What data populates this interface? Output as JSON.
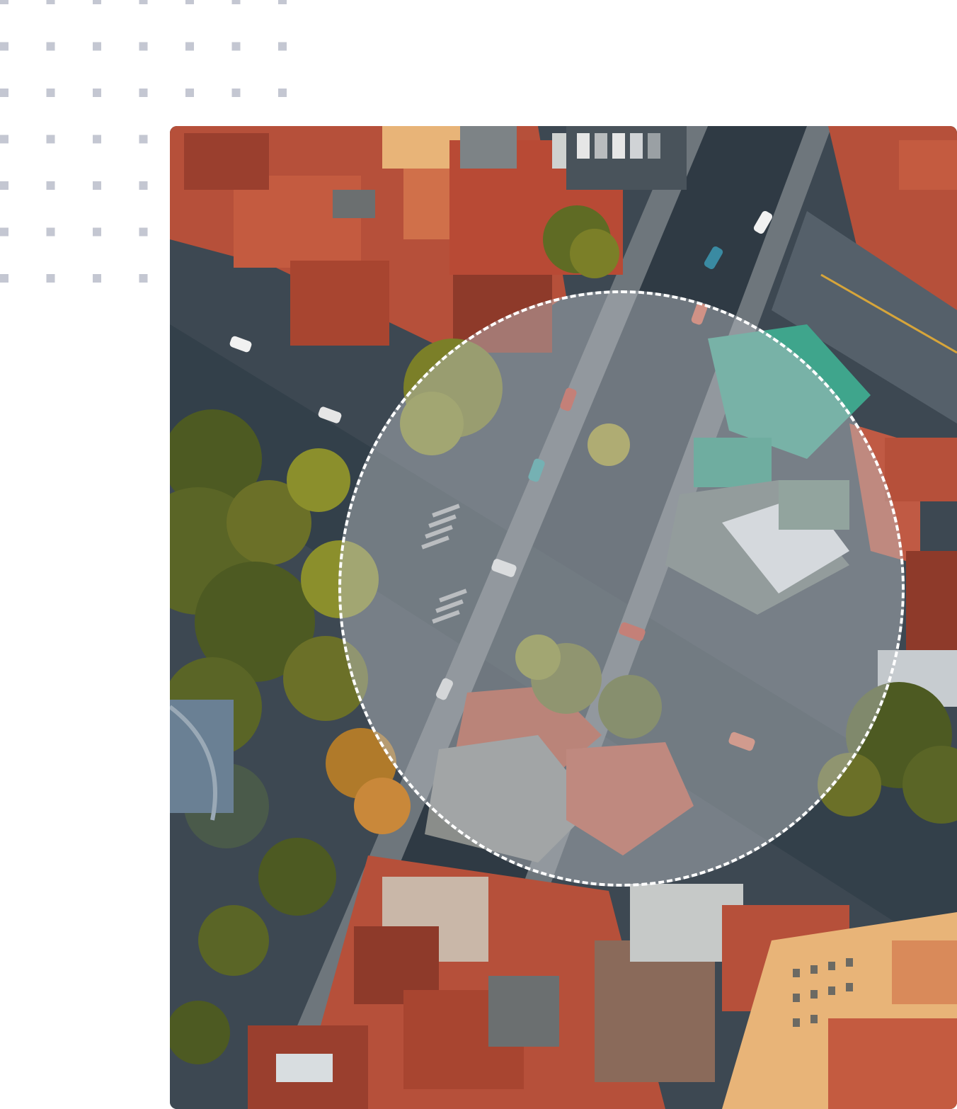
{
  "photo": {
    "subject": "aerial-city-intersection",
    "colors": {
      "roof_red": "#b6503a",
      "roof_dark": "#8e3a2a",
      "roof_orange": "#d0704a",
      "street": "#2f3a44",
      "sidewalk": "#6e767c",
      "tree_dark": "#4d5a22",
      "tree_light": "#8b8f2c",
      "tree_autumn": "#b07a2a",
      "roof_teal": "#3fa58c",
      "roof_gray": "#8c8e8a",
      "facade_yellow": "#e8b478",
      "overlay": "#bec3c8"
    }
  },
  "decor": {
    "dot_color": "#c4c7d2"
  }
}
